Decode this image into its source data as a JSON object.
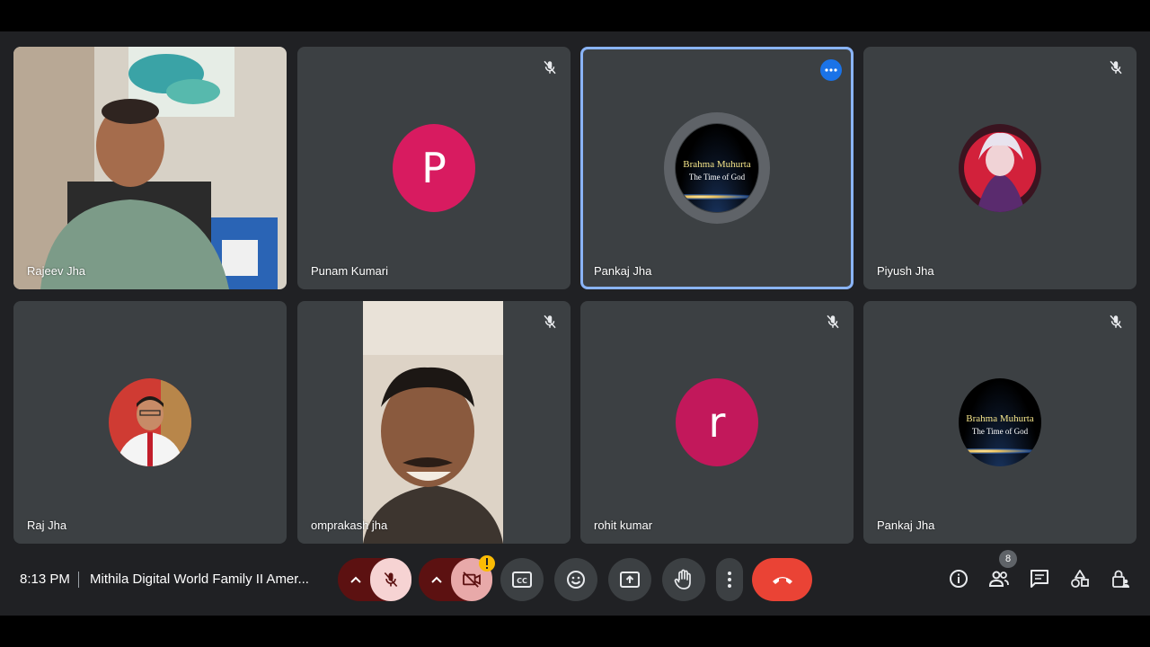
{
  "meeting": {
    "time": "8:13 PM",
    "title": "Mithila Digital World Family II Amer..."
  },
  "participants": [
    {
      "name": "Rajeev Jha",
      "type": "video"
    },
    {
      "name": "Punam Kumari",
      "type": "letter",
      "letter": "P",
      "color": "#d81b60"
    },
    {
      "name": "Pankaj Jha",
      "type": "brahma",
      "active": true
    },
    {
      "name": "Piyush Jha",
      "type": "image"
    },
    {
      "name": "Raj Jha",
      "type": "image"
    },
    {
      "name": "omprakash jha",
      "type": "video"
    },
    {
      "name": "rohit kumar",
      "type": "letter",
      "letter": "r",
      "color": "#c2185b"
    },
    {
      "name": "Pankaj Jha",
      "type": "brahma"
    }
  ],
  "brahma": {
    "line1": "Brahma Muhurta",
    "line2": "The Time of God"
  },
  "people_count": "8",
  "colors": {
    "bg": "#202124",
    "tile": "#3c4043",
    "accent": "#8ab4f8",
    "danger": "#ea4335",
    "mic_off_bg": "#f6d3d3"
  }
}
